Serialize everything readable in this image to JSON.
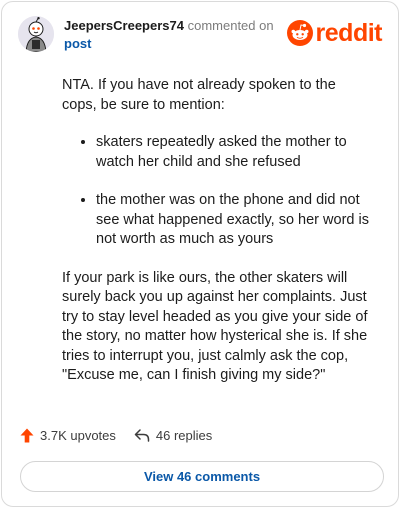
{
  "comment": {
    "username": "JeepersCreepers74",
    "meta_suffix": " commented on",
    "post_link": "post",
    "intro": "NTA. If you have not already spoken to the cops, be sure to mention:",
    "bullets": [
      "skaters repeatedly asked the mother to watch her child and she refused",
      "the mother was on the phone and did not see what happened exactly, so her word is not worth as much as yours"
    ],
    "closing": "If your park is like ours, the other skaters will surely back you up against her complaints. Just try to stay level headed as you give your side of the story, no matter how hysterical she is. If she tries to interrupt you, just calmly ask the cop, \"Excuse me, can I finish giving my side?\""
  },
  "logo": {
    "wordmark": "reddit",
    "icon": "reddit-snoo-icon"
  },
  "actions": {
    "upvotes_label": "3.7K upvotes",
    "upvote_icon": "upvote-arrow-icon",
    "replies_label": "46 replies",
    "reply_icon": "reply-arrow-icon"
  },
  "view_comments_label": "View 46 comments",
  "colors": {
    "brand": "#ff4500",
    "link": "#0a58a8",
    "text": "#1c1c1c",
    "muted": "#7c7c7c"
  }
}
